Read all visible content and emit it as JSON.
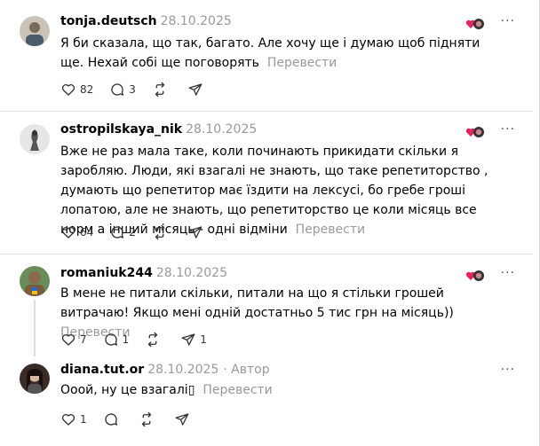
{
  "comments": [
    {
      "username": "tonja.deutsch",
      "date": "28.10.2025",
      "text": "Я би сказала, що так, багато. Але хочу ще і думаю щоб підняти ще. Нехай собі ще поговорять",
      "translate": "Перевести",
      "likes": "82",
      "replies": "3",
      "reposts": "",
      "shares": ""
    },
    {
      "username": "ostropilskaya_nik",
      "date": "28.10.2025",
      "text": "Вже не раз мала таке, коли починають прикидати скільки я заробляю. Люди, які взагалі не знають, що таке репетиторство , думають що репетитор має їздити на лексусі, бо гребе гроші лопатою, але не знають, що репетиторство це коли місяць все норм а інший місяць - одні відміни",
      "translate": "Перевести",
      "likes": "64",
      "replies": "2",
      "reposts": "",
      "shares": ""
    },
    {
      "username": "romaniuk244",
      "date": "28.10.2025",
      "text": "В мене не питали скільки, питали на що я стільки грошей витрачаю! Якщо мені одній достатньо 5 тис грн на місяць))",
      "translate": "Перевести",
      "likes": "7",
      "replies": "1",
      "reposts": "",
      "shares": "1"
    },
    {
      "username": "diana.tut.or",
      "date": "28.10.2025",
      "author_label": "· Автор",
      "text": "Ооой, ну це взагалі",
      "text_glyph": "▯",
      "translate": "Перевести",
      "likes": "1",
      "replies": "",
      "reposts": "",
      "shares": ""
    }
  ],
  "more_label": "···",
  "colors": {
    "muted": "#999999",
    "divider": "#e0e0e0",
    "reaction_heart": "#e0245e"
  },
  "icons": [
    "heart-icon",
    "comment-icon",
    "repost-icon",
    "share-icon",
    "more-icon",
    "reaction-icon"
  ]
}
